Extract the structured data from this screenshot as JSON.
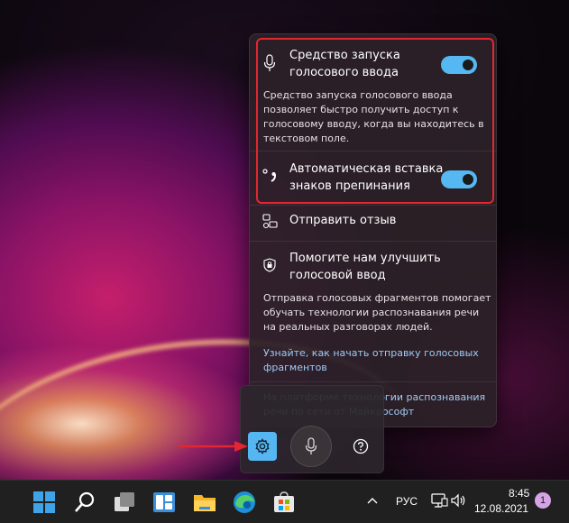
{
  "flyout": {
    "launcher": {
      "title": "Средство запуска голосового ввода",
      "title_line1": "Средство запуска",
      "title_line2": "голосового ввода",
      "toggle_on": true,
      "description_lines": [
        "Средство запуска голосового ввода",
        "позволяет быстро получить доступ к",
        "голосовому вводу, когда вы находитесь в",
        "текстовом поле."
      ]
    },
    "auto_punctuation": {
      "title_line1": "Автоматическая вставка",
      "title_line2": "знаков препинания",
      "toggle_on": true
    },
    "feedback": {
      "label": "Отправить отзыв"
    },
    "improve": {
      "title_line1": "Помогите нам улучшить",
      "title_line2": "голосовой ввод",
      "description_lines": [
        "Отправка голосовых фрагментов помогает",
        "обучать технологии распознавания речи",
        "на реальных разговорах людей."
      ],
      "link_lines": [
        "Узнайте, как начать отправку голосовых",
        "фрагментов"
      ]
    },
    "footer_link_lines": [
      "На платформе технологии распознавания",
      "речи по сети от Майкрософт"
    ]
  },
  "icons": {
    "microphone": "microphone-icon",
    "punctuation": "punctuation-icon",
    "feedback": "feedback-icon",
    "shield": "shield-lock-icon",
    "settings": "gear-icon",
    "help": "help-icon"
  },
  "taskbar": {
    "language": "РУС",
    "time": "8:45",
    "date": "12.08.2021",
    "notification_count": "1"
  },
  "colors": {
    "accent": "#56b8f3",
    "highlight": "#e3262f",
    "link": "#9ecbf5"
  }
}
